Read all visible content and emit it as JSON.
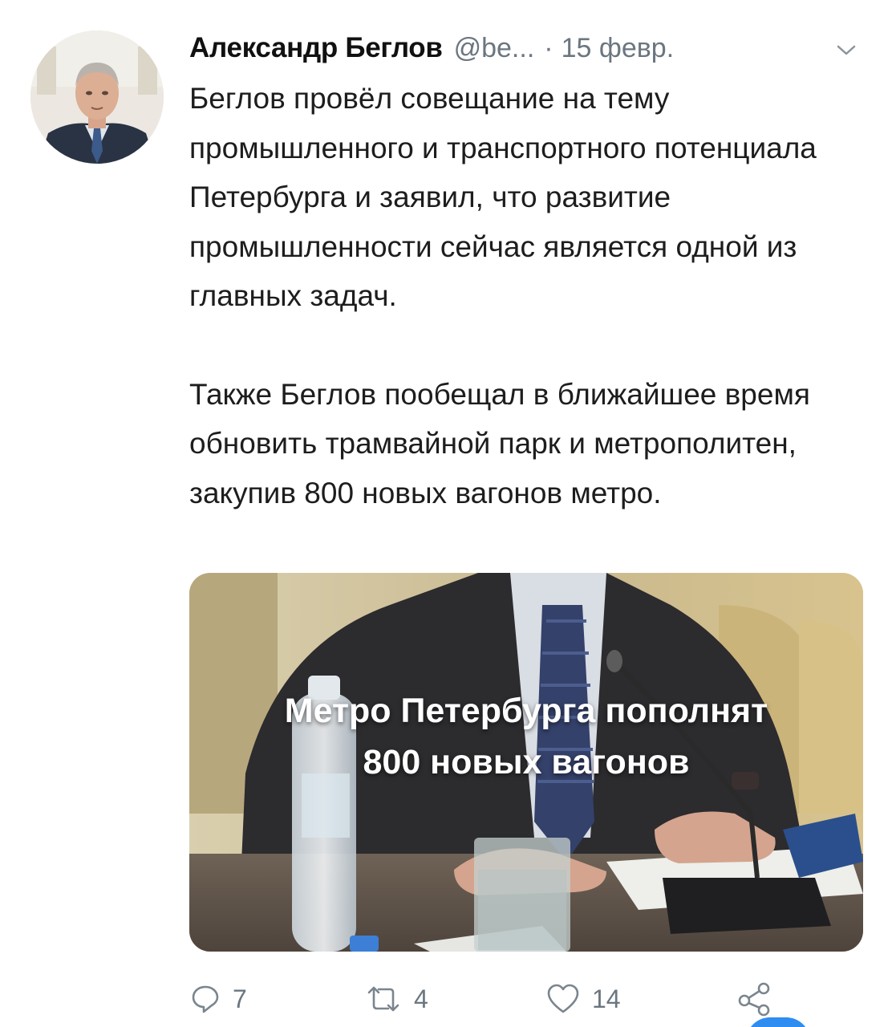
{
  "tweet": {
    "author_name": "Александр Беглов",
    "handle": "@be...",
    "separator": "·",
    "date": "15 февр.",
    "paragraphs": [
      "Беглов провёл совещание на тему промышленного и транспортного потенциала Петербурга и заявил, что развитие промышленности сейчас является одной из главных задач.",
      "Также Беглов пообещал в ближайшее время обновить трамвайной парк и метрополитен, закупив 800 новых вагонов метро."
    ],
    "media": {
      "caption_line1": "Метро Петербурга пополнят",
      "caption_line2": "800 новых вагонов"
    },
    "actions": {
      "reply_count": "7",
      "retweet_count": "4",
      "like_count": "14"
    }
  },
  "icons": {
    "menu": "chevron-down-icon",
    "reply": "reply-icon",
    "retweet": "retweet-icon",
    "like": "heart-icon",
    "share": "share-icon"
  },
  "colors": {
    "text": "#1d1d1d",
    "muted": "#6b7680",
    "accent": "#2f8cf0"
  }
}
